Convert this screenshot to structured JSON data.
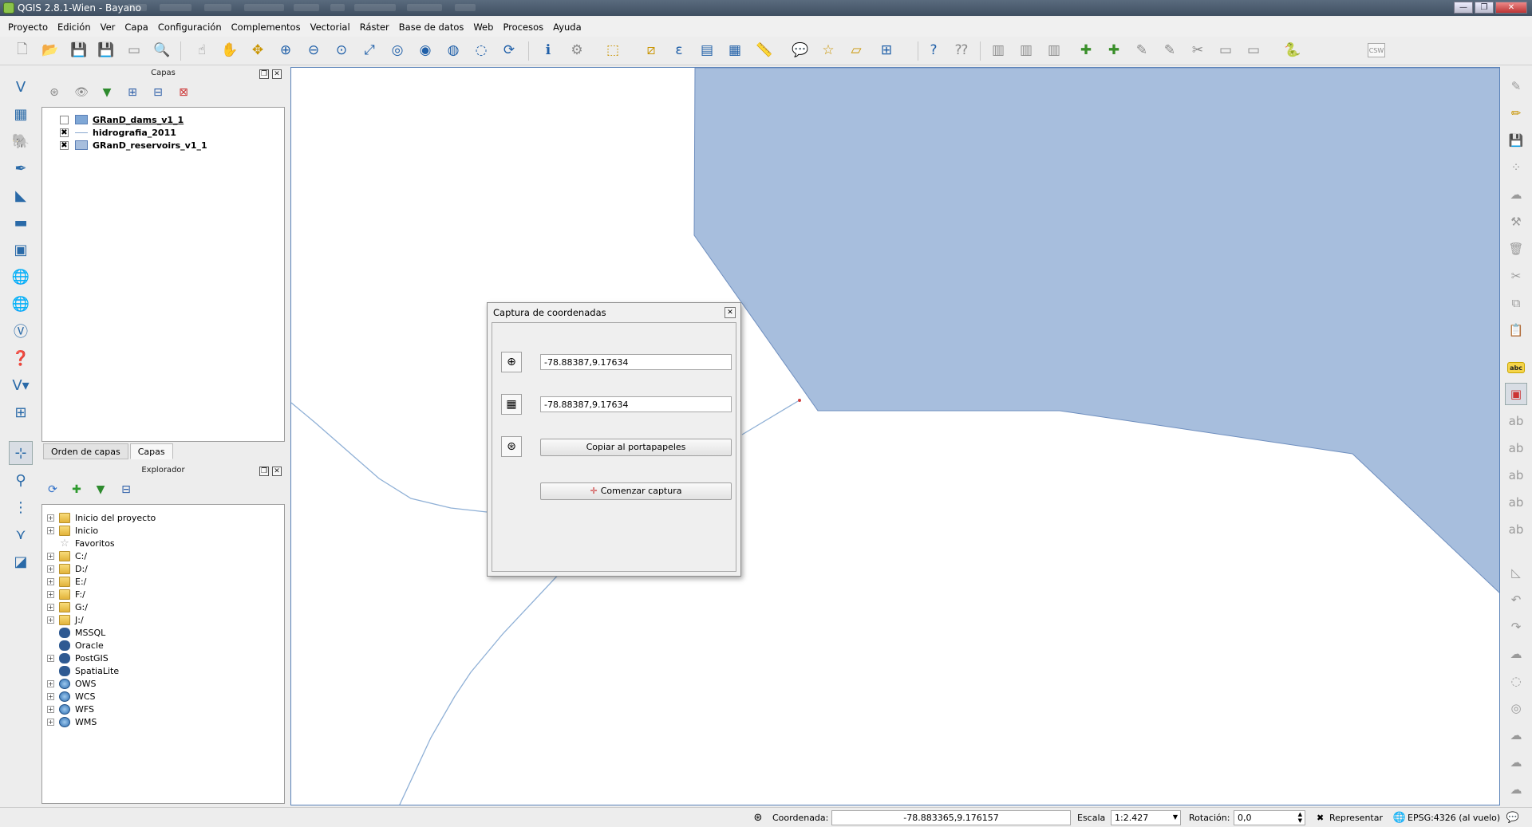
{
  "window": {
    "title": "QGIS 2.8.1-Wien - Bayano",
    "controls": [
      "—",
      "❐",
      "✕"
    ]
  },
  "menubar": [
    "Proyecto",
    "Edición",
    "Ver",
    "Capa",
    "Configuración",
    "Complementos",
    "Vectorial",
    "Ráster",
    "Base de datos",
    "Web",
    "Procesos",
    "Ayuda"
  ],
  "layers_panel": {
    "title": "Capas",
    "layers": [
      {
        "name": "GRanD_dams_v1_1",
        "checked": "",
        "symbol": "polygon",
        "color": "#7fa7d6"
      },
      {
        "name": "hidrografia_2011",
        "checked": "✖",
        "symbol": "line",
        "color": "#8aa9cf"
      },
      {
        "name": "GRanD_reservoirs_v1_1",
        "checked": "✖",
        "symbol": "polygon",
        "color": "#a7bedd"
      }
    ]
  },
  "tabs": [
    "Orden de capas",
    "Capas"
  ],
  "browser_panel": {
    "title": "Explorador",
    "items": [
      {
        "label": "Inicio del proyecto",
        "icon": "folder-icon",
        "expandable": true
      },
      {
        "label": "Inicio",
        "icon": "folder-icon",
        "expandable": true
      },
      {
        "label": "Favoritos",
        "icon": "star-icon",
        "expandable": false
      },
      {
        "label": "C:/",
        "icon": "folder-icon",
        "expandable": true
      },
      {
        "label": "D:/",
        "icon": "folder-icon",
        "expandable": true
      },
      {
        "label": "E:/",
        "icon": "folder-icon",
        "expandable": true
      },
      {
        "label": "F:/",
        "icon": "folder-icon",
        "expandable": true
      },
      {
        "label": "G:/",
        "icon": "folder-icon",
        "expandable": true
      },
      {
        "label": "J:/",
        "icon": "folder-icon",
        "expandable": true
      },
      {
        "label": "MSSQL",
        "icon": "mssql-icon",
        "expandable": false
      },
      {
        "label": "Oracle",
        "icon": "database-icon",
        "expandable": false
      },
      {
        "label": "PostGIS",
        "icon": "postgis-icon",
        "expandable": true
      },
      {
        "label": "SpatiaLite",
        "icon": "spatialite-icon",
        "expandable": false
      },
      {
        "label": "OWS",
        "icon": "globe-icon",
        "expandable": true
      },
      {
        "label": "WCS",
        "icon": "globe-icon",
        "expandable": true
      },
      {
        "label": "WFS",
        "icon": "globe-icon",
        "expandable": true
      },
      {
        "label": "WMS",
        "icon": "globe-icon",
        "expandable": true
      }
    ]
  },
  "dialog": {
    "title": "Captura de coordenadas",
    "coord_map": "-78.88387,9.17634",
    "coord_crs": "-78.88387,9.17634",
    "copy_button": "Copiar al portapapeles",
    "start_button": "Comenzar captura",
    "close": "✕"
  },
  "toolbar_extra": {
    "csw_label": "CSW"
  },
  "map": {
    "reservoir_fill": "#a7bedd",
    "reservoir_stroke": "#6f8fbf",
    "river_color": "#8fb0d6",
    "point_color": "#d04040"
  },
  "statusbar": {
    "coordinate_label": "Coordenada:",
    "coordinate_value": "-78.883365,9.176157",
    "scale_label": "Escala",
    "scale_value": "1:2.427",
    "rotation_label": "Rotación:",
    "rotation_value": "0,0",
    "render_label": "Representar",
    "render_checked": "✖",
    "crs_label": "EPSG:4326 (al vuelo)"
  },
  "right_labels": {
    "abc": "abc"
  }
}
